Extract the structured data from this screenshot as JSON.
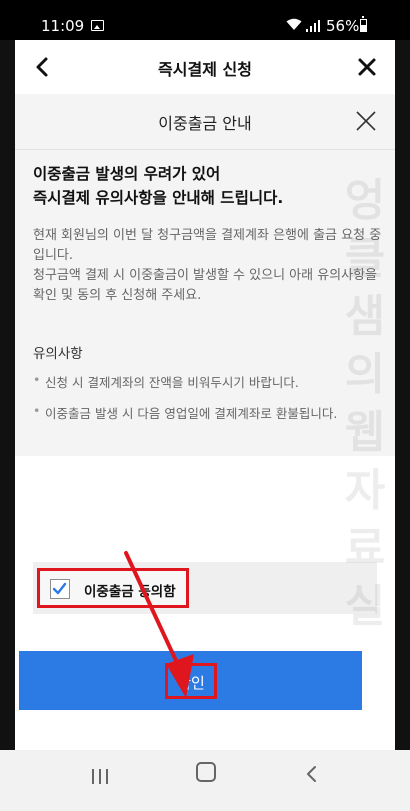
{
  "status_bar": {
    "time": "11:09",
    "battery": "56%"
  },
  "app_bar": {
    "title": "즉시결제 신청"
  },
  "sheet": {
    "title": "이중출금 안내",
    "headline_line1": "이중출금 발생의 우려가 있어",
    "headline_line2": "즉시결제 유의사항을 안내해 드립니다.",
    "desc_p1": "현재 회원님의 이번 달 청구금액을 결제계좌 은행에 출금 요청 중입니다.",
    "desc_p2": "청구금액 결제 시 이중출금이 발생할 수 있으니 아래 유의사항을 확인 및 동의 후 신청해 주세요.",
    "notes_title": "유의사항",
    "notes": [
      "신청 시 결제계좌의 잔액을 비워두시기 바랍니다.",
      "이중출금 발생 시 다음 영업일에 결제계좌로 환불됩니다."
    ],
    "agree_label": "이중출금 동의함",
    "agree_checked": true,
    "confirm_label": "확인"
  },
  "watermark": [
    "엉",
    "클",
    "샘",
    "의",
    "웹",
    "자",
    "료",
    "실"
  ],
  "colors": {
    "accent": "#2c7be5",
    "highlight": "#e0161f"
  }
}
